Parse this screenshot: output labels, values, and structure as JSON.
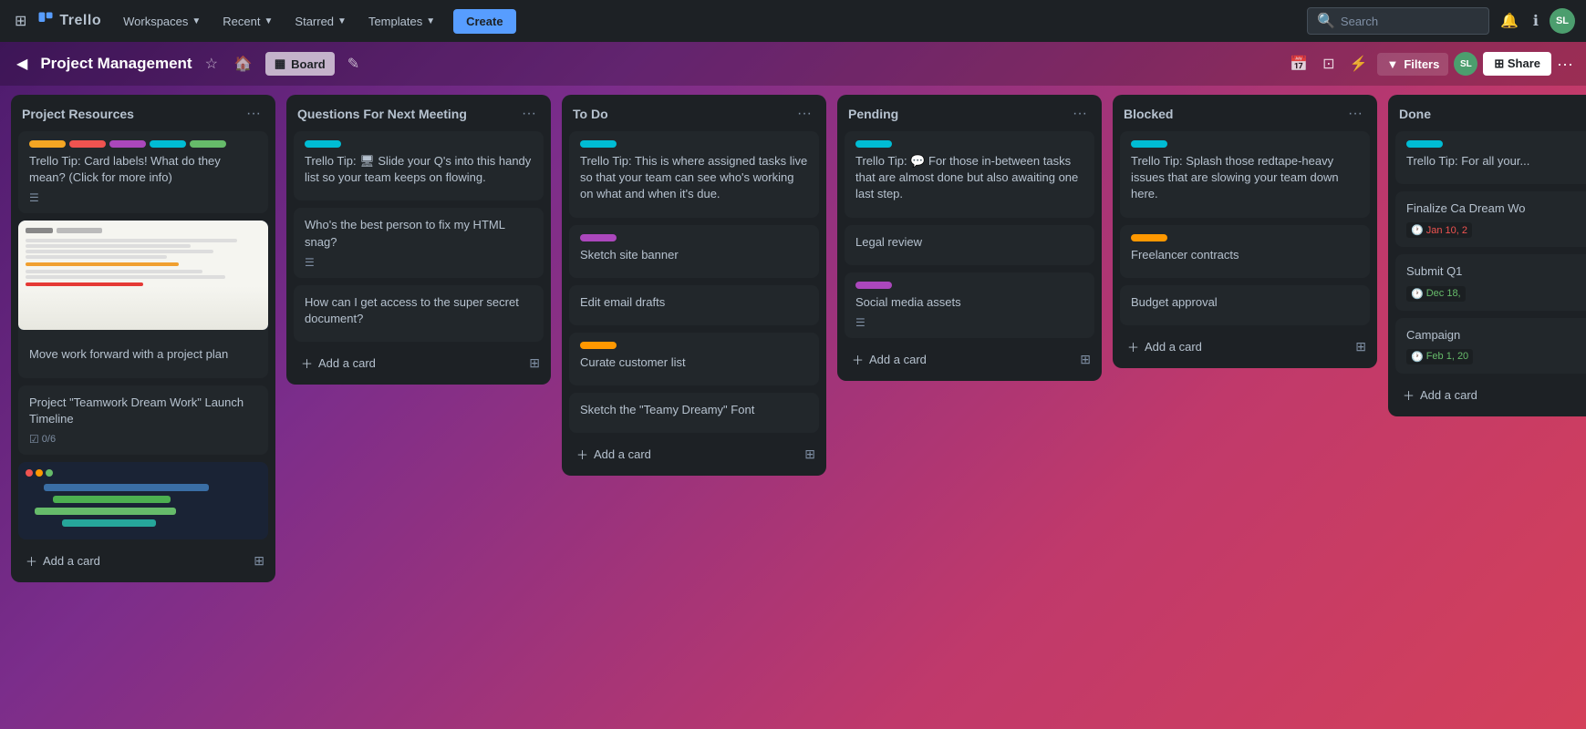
{
  "app": {
    "logo_text": "Trello",
    "nav_items": [
      {
        "label": "Workspaces",
        "id": "workspaces"
      },
      {
        "label": "Recent",
        "id": "recent"
      },
      {
        "label": "Starred",
        "id": "starred"
      },
      {
        "label": "Templates",
        "id": "templates"
      }
    ],
    "create_label": "Create",
    "search_placeholder": "Search",
    "avatar_initials": "SL"
  },
  "board": {
    "title": "Project Management",
    "view_label": "Board",
    "share_label": "Share",
    "filter_label": "Filters",
    "avatar_initials": "SL"
  },
  "lists": [
    {
      "id": "project-resources",
      "title": "Project Resources",
      "cards": [
        {
          "id": "tip-labels",
          "labels": [
            "yellow",
            "red",
            "purple",
            "cyan",
            "green"
          ],
          "title": "Trello Tip: Card labels! What do they mean? (Click for more info)",
          "has_desc": true
        },
        {
          "id": "project-plan",
          "has_image": true,
          "image_type": "document",
          "title": "Move work forward with a project plan"
        },
        {
          "id": "teamwork-timeline",
          "title": "Project \"Teamwork Dream Work\" Launch Timeline",
          "badges": [
            {
              "icon": "checklist",
              "text": "0/6"
            }
          ],
          "has_desc": false
        },
        {
          "id": "timeline-card",
          "has_image": true,
          "image_type": "timeline",
          "title": ""
        }
      ]
    },
    {
      "id": "questions-next-meeting",
      "title": "Questions For Next Meeting",
      "cards": [
        {
          "id": "tip-slide",
          "labels": [
            "cyan"
          ],
          "title": "Trello Tip: 🖥 Slide your Q's into this handy list so your team keeps on flowing.",
          "has_desc": false
        },
        {
          "id": "html-snag",
          "title": "Who's the best person to fix my HTML snag?",
          "has_desc": true
        },
        {
          "id": "secret-doc",
          "title": "How can I get access to the super secret document?",
          "has_desc": false
        }
      ]
    },
    {
      "id": "to-do",
      "title": "To Do",
      "cards": [
        {
          "id": "tip-assigned",
          "labels": [
            "cyan"
          ],
          "title": "Trello Tip: This is where assigned tasks live so that your team can see who's working on what and when it's due.",
          "has_desc": false
        },
        {
          "id": "sketch-banner",
          "labels": [
            "purple"
          ],
          "title": "Sketch site banner",
          "has_desc": false
        },
        {
          "id": "edit-email",
          "title": "Edit email drafts",
          "has_desc": false
        },
        {
          "id": "curate-customers",
          "labels": [
            "orange"
          ],
          "title": "Curate customer list",
          "has_desc": false
        },
        {
          "id": "sketch-font",
          "title": "Sketch the \"Teamy Dreamy\" Font",
          "has_desc": false
        }
      ]
    },
    {
      "id": "pending",
      "title": "Pending",
      "cards": [
        {
          "id": "tip-inbetween",
          "labels": [
            "cyan"
          ],
          "title": "Trello Tip: 💬 For those in-between tasks that are almost done but also awaiting one last step.",
          "has_desc": false
        },
        {
          "id": "legal-review",
          "title": "Legal review",
          "has_desc": false
        },
        {
          "id": "social-media",
          "labels": [
            "purple"
          ],
          "title": "Social media assets",
          "has_desc": true
        }
      ]
    },
    {
      "id": "blocked",
      "title": "Blocked",
      "cards": [
        {
          "id": "tip-splash",
          "labels": [
            "cyan"
          ],
          "title": "Trello Tip: Splash those redtape-heavy issues that are slowing your team down here.",
          "has_desc": false
        },
        {
          "id": "freelancer-contracts",
          "labels": [
            "orange"
          ],
          "title": "Freelancer contracts",
          "has_desc": false
        },
        {
          "id": "budget-approval",
          "title": "Budget approval",
          "has_desc": false
        }
      ]
    },
    {
      "id": "done",
      "title": "Done",
      "cards": [
        {
          "id": "tip-done",
          "labels": [
            "cyan"
          ],
          "title": "Trello Tip: For all your...",
          "has_desc": false,
          "partial": true
        },
        {
          "id": "finalize-ca",
          "title": "Finalize Ca Dream Wo",
          "date": "Jan 10, 2",
          "date_color": "red"
        },
        {
          "id": "submit-q1",
          "title": "Submit Q1",
          "date": "Dec 18,",
          "date_color": "green"
        },
        {
          "id": "campaign",
          "title": "Campaign",
          "date": "Feb 1, 20",
          "date_color": "green"
        }
      ]
    }
  ],
  "ui": {
    "add_card_label": "+ Add a card",
    "add_card_icon": "＋",
    "menu_icon": "•••",
    "star_icon": "☆",
    "share_icon": "⊞"
  }
}
